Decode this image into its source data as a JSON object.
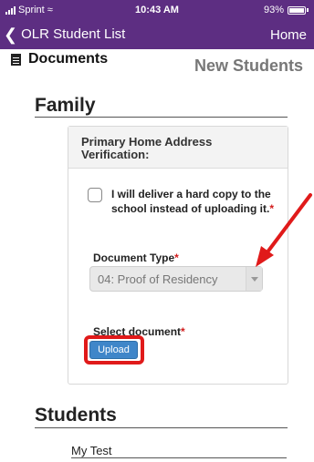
{
  "status_bar": {
    "carrier": "Sprint",
    "time": "10:43 AM",
    "battery": "93%"
  },
  "nav": {
    "back_label": "OLR Student List",
    "home_label": "Home"
  },
  "page": {
    "documents_label": "Documents",
    "new_students_label": "New Students"
  },
  "family": {
    "title": "Family",
    "card_title": "Primary Home Address Verification:",
    "checkbox_label": "I will deliver a hard copy to the school instead of uploading it.",
    "required_mark": "*",
    "document_type_label": "Document Type",
    "document_type_value": "04: Proof of Residency",
    "select_document_label": "Select document",
    "upload_label": "Upload"
  },
  "students": {
    "title": "Students",
    "items": [
      "My Test"
    ]
  },
  "colors": {
    "nav_bg": "#5d2e82",
    "required": "#d21c1c",
    "upload_button": "#3f86c9",
    "annotation": "#e01a1a"
  }
}
